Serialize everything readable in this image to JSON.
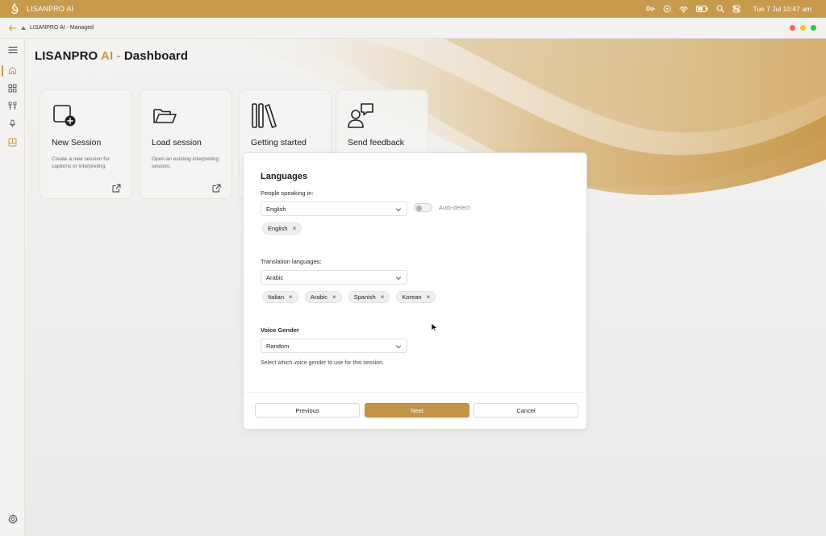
{
  "system_bar": {
    "app_name": "LISANPRO AI",
    "clock": "Tue 7 Jul  10:47 am",
    "colors": {
      "bar": "#c89a4b"
    },
    "icons": [
      "app-logo-icon",
      "microphone-waveform-icon",
      "play-circle-icon",
      "wifi-icon",
      "battery-icon",
      "search-icon",
      "control-center-icon"
    ]
  },
  "app_bar": {
    "title": "LISANPRO AI - Managed",
    "window_controls": [
      "close",
      "minimize",
      "maximize"
    ]
  },
  "sidebar": {
    "items": [
      "menu-icon",
      "home-icon",
      "grid-icon",
      "tools-icon",
      "microphone-icon",
      "book-icon"
    ],
    "bottom": "gear-icon"
  },
  "page": {
    "title_prefix": "LISANPRO ",
    "title_ai": "AI",
    "title_sep": " - ",
    "title_suffix": "Dashboard",
    "accent": "#c89a4b"
  },
  "cards": [
    {
      "title": "New Session",
      "description": "Create a new session for captions or interpreting.",
      "icon": "new-session-icon"
    },
    {
      "title": "Load session",
      "description": "Open an existing interpreting session.",
      "icon": "folder-open-icon"
    },
    {
      "title": "Getting started",
      "description": "",
      "icon": "library-books-icon"
    },
    {
      "title": "Send feedback",
      "description": "",
      "icon": "feedback-person-icon"
    }
  ],
  "modal": {
    "heading": "Languages",
    "speaking": {
      "label": "People speaking in:",
      "selected": "English",
      "auto_detect_label": "Auto-detect",
      "auto_detect_on": false,
      "chips": [
        "English"
      ]
    },
    "translation": {
      "label": "Translation languages:",
      "selected": "Arabic",
      "chips": [
        "Italian",
        "Arabic",
        "Spanish",
        "Korean"
      ]
    },
    "voice": {
      "label": "Voice Gender",
      "selected": "Random",
      "help": "Select which voice gender to use for this session."
    },
    "buttons": {
      "previous": "Previous",
      "next": "Next",
      "cancel": "Cancel"
    }
  }
}
